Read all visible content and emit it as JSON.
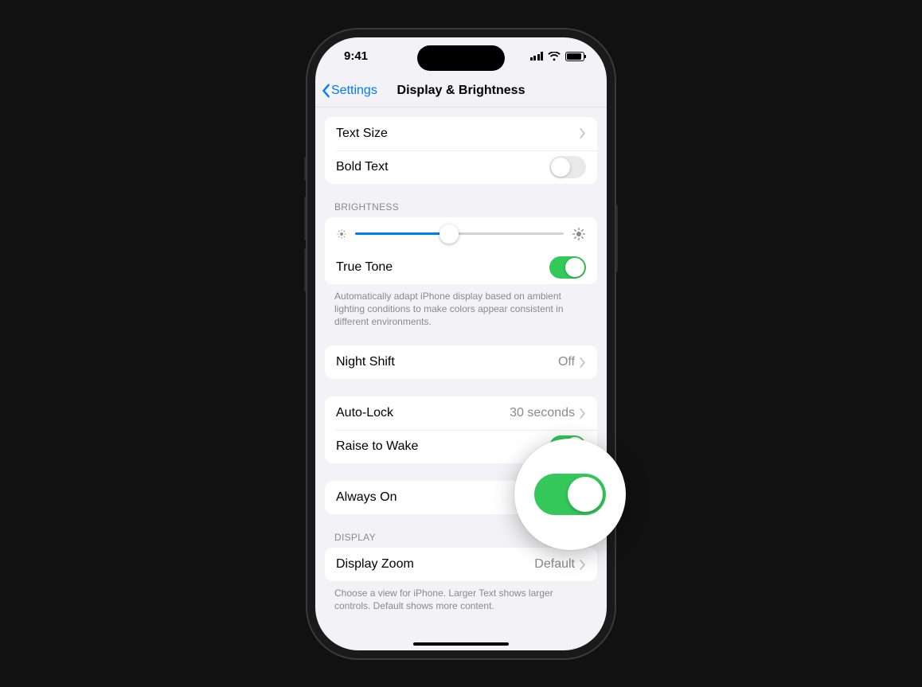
{
  "statusbar": {
    "time": "9:41"
  },
  "nav": {
    "back_label": "Settings",
    "title": "Display & Brightness"
  },
  "group_text": {
    "text_size_label": "Text Size",
    "bold_text_label": "Bold Text",
    "bold_text_on": false
  },
  "brightness": {
    "header": "BRIGHTNESS",
    "slider_percent": 45,
    "true_tone_label": "True Tone",
    "true_tone_on": true,
    "footer": "Automatically adapt iPhone display based on ambient lighting conditions to make colors appear consistent in different environments."
  },
  "night_shift": {
    "label": "Night Shift",
    "value": "Off"
  },
  "auto_lock": {
    "auto_lock_label": "Auto-Lock",
    "auto_lock_value": "30 seconds",
    "raise_to_wake_label": "Raise to Wake",
    "raise_to_wake_on": true
  },
  "always_on": {
    "label": "Always On",
    "on": true
  },
  "display": {
    "header": "DISPLAY",
    "display_zoom_label": "Display Zoom",
    "display_zoom_value": "Default",
    "footer": "Choose a view for iPhone. Larger Text shows larger controls. Default shows more content."
  }
}
